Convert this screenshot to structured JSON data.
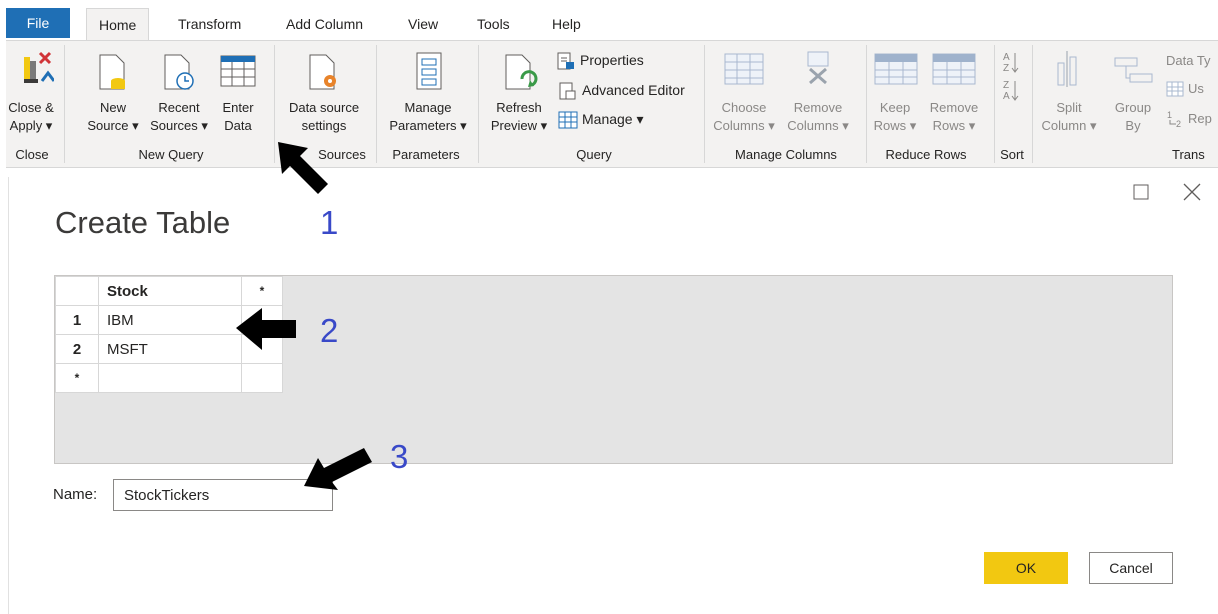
{
  "tabs": [
    "File",
    "Home",
    "Transform",
    "Add Column",
    "View",
    "Tools",
    "Help"
  ],
  "ribbon": {
    "close_apply": [
      "Close &",
      "Apply ▾"
    ],
    "new_source": [
      "New",
      "Source ▾"
    ],
    "recent_sources": [
      "Recent",
      "Sources ▾"
    ],
    "enter_data": [
      "Enter",
      "Data"
    ],
    "data_source_settings": [
      "Data source",
      "settings"
    ],
    "manage_parameters": [
      "Manage",
      "Parameters ▾"
    ],
    "refresh_preview": [
      "Refresh",
      "Preview ▾"
    ],
    "properties": "Properties",
    "advanced_editor": "Advanced Editor",
    "manage": "Manage ▾",
    "choose_columns": [
      "Choose",
      "Columns ▾"
    ],
    "remove_columns": [
      "Remove",
      "Columns ▾"
    ],
    "keep_rows": [
      "Keep",
      "Rows ▾"
    ],
    "remove_rows": [
      "Remove",
      "Rows ▾"
    ],
    "split_column": [
      "Split",
      "Column ▾"
    ],
    "group_by": [
      "Group",
      "By"
    ],
    "data_type": "Data Ty",
    "use": "Us",
    "replace": "Rep",
    "groups": {
      "close": "Close",
      "new_query": "New Query",
      "data_sources": "Sources",
      "parameters": "Parameters",
      "query": "Query",
      "manage_columns": "Manage Columns",
      "reduce_rows": "Reduce Rows",
      "sort": "Sort",
      "transform": "Trans"
    }
  },
  "dialog": {
    "title": "Create Table",
    "column_header": "Stock",
    "new_column_marker": "*",
    "rows": [
      {
        "num": "1",
        "value": "IBM"
      },
      {
        "num": "2",
        "value": "MSFT"
      }
    ],
    "new_row_marker": "*",
    "name_label": "Name:",
    "name_value": "StockTickers",
    "ok_label": "OK",
    "cancel_label": "Cancel"
  },
  "callouts": [
    "1",
    "2",
    "3"
  ]
}
